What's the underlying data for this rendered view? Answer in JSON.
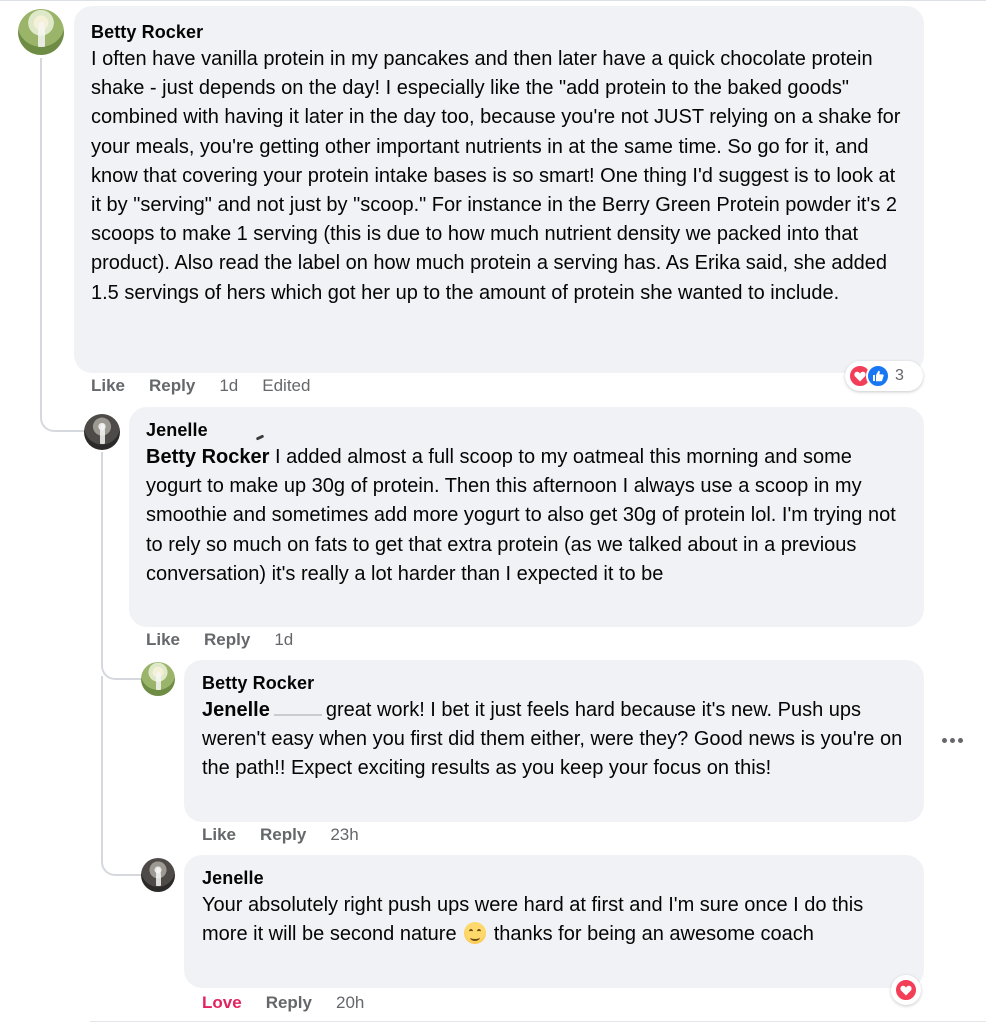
{
  "comments": [
    {
      "author": "Betty Rocker",
      "text": "I often have vanilla protein in my pancakes and then later have a quick chocolate protein shake - just depends on the day! I especially like the \"add protein to the baked goods\" combined with having it later in the day too, because you're not JUST relying on a shake for your meals, you're getting other important nutrients in at the same time. So go for it, and know that covering your protein intake bases is so smart! One thing I'd suggest is to look at it by \"serving\" and not just by \"scoop.\" For instance in the Berry Green Protein powder it's 2 scoops to make 1 serving (this is due to how much nutrient density we packed into that product). Also read the label on how much protein a serving has. As Erika said, she added 1.5 servings of hers which got her up to the amount of protein she wanted to include.",
      "like_label": "Like",
      "reply_label": "Reply",
      "time": "1d",
      "edited": "Edited",
      "reactions": {
        "icons": [
          "heart-icon",
          "like-icon"
        ],
        "count": "3"
      }
    },
    {
      "author": "Jenelle",
      "mention": "Betty Rocker",
      "text": "I added almost a full scoop to my oatmeal this morning and some yogurt to make up 30g of protein. Then this afternoon I always use a scoop in my smoothie and sometimes add more yogurt to also get 30g of protein lol. I'm trying not to rely so much on fats to get that extra protein (as we talked about in a previous conversation) it's really a lot harder than I expected it to be",
      "like_label": "Like",
      "reply_label": "Reply",
      "time": "1d"
    },
    {
      "author": "Betty Rocker",
      "mention": "Jenelle",
      "text": "great work! I bet it just feels hard because it's new. Push ups weren't easy when you first did them either, were they? Good news is you're on the path!! Expect exciting results as you keep your focus on this!",
      "like_label": "Like",
      "reply_label": "Reply",
      "time": "23h",
      "more_icon": "more-horizontal-icon"
    },
    {
      "author": "Jenelle",
      "text_before_emoji": "Your absolutely right push ups were hard at first and I'm sure once I do this more it will be second nature",
      "emoji": "smiling-face-emoji",
      "text_after_emoji": "thanks for being an awesome coach",
      "love_label": "Love",
      "reply_label": "Reply",
      "time": "20h",
      "reactions": {
        "icons": [
          "heart-icon"
        ]
      }
    }
  ],
  "colors": {
    "bubble": "#f0f2f5",
    "meta": "#65676b",
    "love": "#e0245e",
    "like_blue": "#1877f2",
    "heart_red": "#f33e58"
  }
}
